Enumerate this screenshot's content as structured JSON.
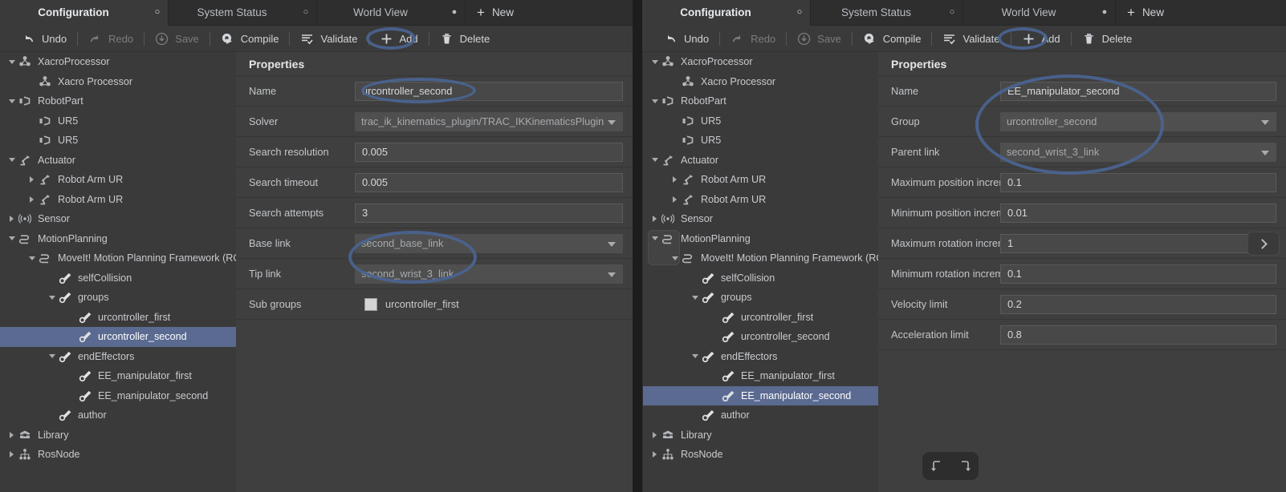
{
  "tabs": [
    {
      "label": "Configuration",
      "dot": "hollow",
      "active": true
    },
    {
      "label": "System Status",
      "dot": "hollow",
      "active": false
    },
    {
      "label": "World View",
      "dot": "filled",
      "active": false
    }
  ],
  "new_tab_label": "New",
  "toolbar": [
    {
      "label": "Undo",
      "icon": "undo-icon",
      "disabled": false
    },
    {
      "label": "Redo",
      "icon": "redo-icon",
      "disabled": true
    },
    {
      "label": "Save",
      "icon": "save-icon",
      "disabled": true
    },
    {
      "label": "Compile",
      "icon": "compile-icon",
      "disabled": false
    },
    {
      "label": "Validate",
      "icon": "validate-icon",
      "disabled": false
    },
    {
      "label": "Add",
      "icon": "plus-icon",
      "disabled": false
    },
    {
      "label": "Delete",
      "icon": "trash-icon",
      "disabled": false
    }
  ],
  "tree": [
    {
      "label": "XacroProcessor",
      "icon": "xacro-icon",
      "depth": 0,
      "twist": "down"
    },
    {
      "label": "Xacro Processor",
      "icon": "xacro-icon",
      "depth": 1,
      "twist": "none"
    },
    {
      "label": "RobotPart",
      "icon": "robotpart-icon",
      "depth": 0,
      "twist": "down"
    },
    {
      "label": "UR5",
      "icon": "robotpart-icon",
      "depth": 1,
      "twist": "none"
    },
    {
      "label": "UR5",
      "icon": "robotpart-icon",
      "depth": 1,
      "twist": "none"
    },
    {
      "label": "Actuator",
      "icon": "actuator-icon",
      "depth": 0,
      "twist": "down"
    },
    {
      "label": "Robot Arm UR",
      "icon": "actuator-icon",
      "depth": 1,
      "twist": "right"
    },
    {
      "label": "Robot Arm UR",
      "icon": "actuator-icon",
      "depth": 1,
      "twist": "right"
    },
    {
      "label": "Sensor",
      "icon": "sensor-icon",
      "depth": 0,
      "twist": "right"
    },
    {
      "label": "MotionPlanning",
      "icon": "motion-icon",
      "depth": 0,
      "twist": "down"
    },
    {
      "label": "MoveIt! Motion Planning Framework (RO",
      "icon": "motion-icon",
      "depth": 1,
      "twist": "down"
    },
    {
      "label": "selfCollision",
      "icon": "wrench-icon",
      "depth": 2,
      "twist": "none"
    },
    {
      "label": "groups",
      "icon": "wrench-icon",
      "depth": 2,
      "twist": "down"
    },
    {
      "label": "urcontroller_first",
      "icon": "wrench-icon",
      "depth": 3,
      "twist": "none"
    },
    {
      "label": "urcontroller_second",
      "icon": "wrench-icon",
      "depth": 3,
      "twist": "none"
    },
    {
      "label": "endEffectors",
      "icon": "wrench-icon",
      "depth": 2,
      "twist": "down"
    },
    {
      "label": "EE_manipulator_first",
      "icon": "wrench-icon",
      "depth": 3,
      "twist": "none"
    },
    {
      "label": "EE_manipulator_second",
      "icon": "wrench-icon",
      "depth": 3,
      "twist": "none"
    },
    {
      "label": "author",
      "icon": "wrench-icon",
      "depth": 2,
      "twist": "none"
    },
    {
      "label": "Library",
      "icon": "library-icon",
      "depth": 0,
      "twist": "right"
    },
    {
      "label": "RosNode",
      "icon": "rosnode-icon",
      "depth": 0,
      "twist": "right"
    }
  ],
  "left": {
    "selected_tree_index": 14,
    "properties_title": "Properties",
    "rows": [
      {
        "label": "Name",
        "value": "urcontroller_second",
        "kind": "text"
      },
      {
        "label": "Solver",
        "value": "trac_ik_kinematics_plugin/TRAC_IKKinematicsPlugin",
        "kind": "combo"
      },
      {
        "label": "Search resolution",
        "value": "0.005",
        "kind": "text"
      },
      {
        "label": "Search timeout",
        "value": "0.005",
        "kind": "text"
      },
      {
        "label": "Search attempts",
        "value": "3",
        "kind": "text"
      },
      {
        "label": "Base link",
        "value": "second_base_link",
        "kind": "combo"
      },
      {
        "label": "Tip link",
        "value": "second_wrist_3_link",
        "kind": "combo"
      },
      {
        "label": "Sub groups",
        "value": "urcontroller_first",
        "kind": "checkbox"
      }
    ]
  },
  "right": {
    "selected_tree_index": 17,
    "properties_title": "Properties",
    "rows": [
      {
        "label": "Name",
        "value": "EE_manipulator_second",
        "kind": "text"
      },
      {
        "label": "Group",
        "value": "urcontroller_second",
        "kind": "combo"
      },
      {
        "label": "Parent link",
        "value": "second_wrist_3_link",
        "kind": "combo"
      },
      {
        "label": "Maximum position increment",
        "value": "0.1",
        "kind": "text"
      },
      {
        "label": "Minimum position increment",
        "value": "0.01",
        "kind": "text"
      },
      {
        "label": "Maximum rotation increment",
        "value": "1",
        "kind": "text",
        "expand": true
      },
      {
        "label": "Minimum rotation increment",
        "value": "0.1",
        "kind": "text"
      },
      {
        "label": "Velocity limit",
        "value": "0.2",
        "kind": "text"
      },
      {
        "label": "Acceleration limit",
        "value": "0.8",
        "kind": "text"
      }
    ],
    "bottom_buttons": [
      {
        "icon": "arrow-undo-curved-icon"
      },
      {
        "icon": "arrow-redo-curved-icon"
      }
    ]
  },
  "annotation_color": "#4a6491"
}
